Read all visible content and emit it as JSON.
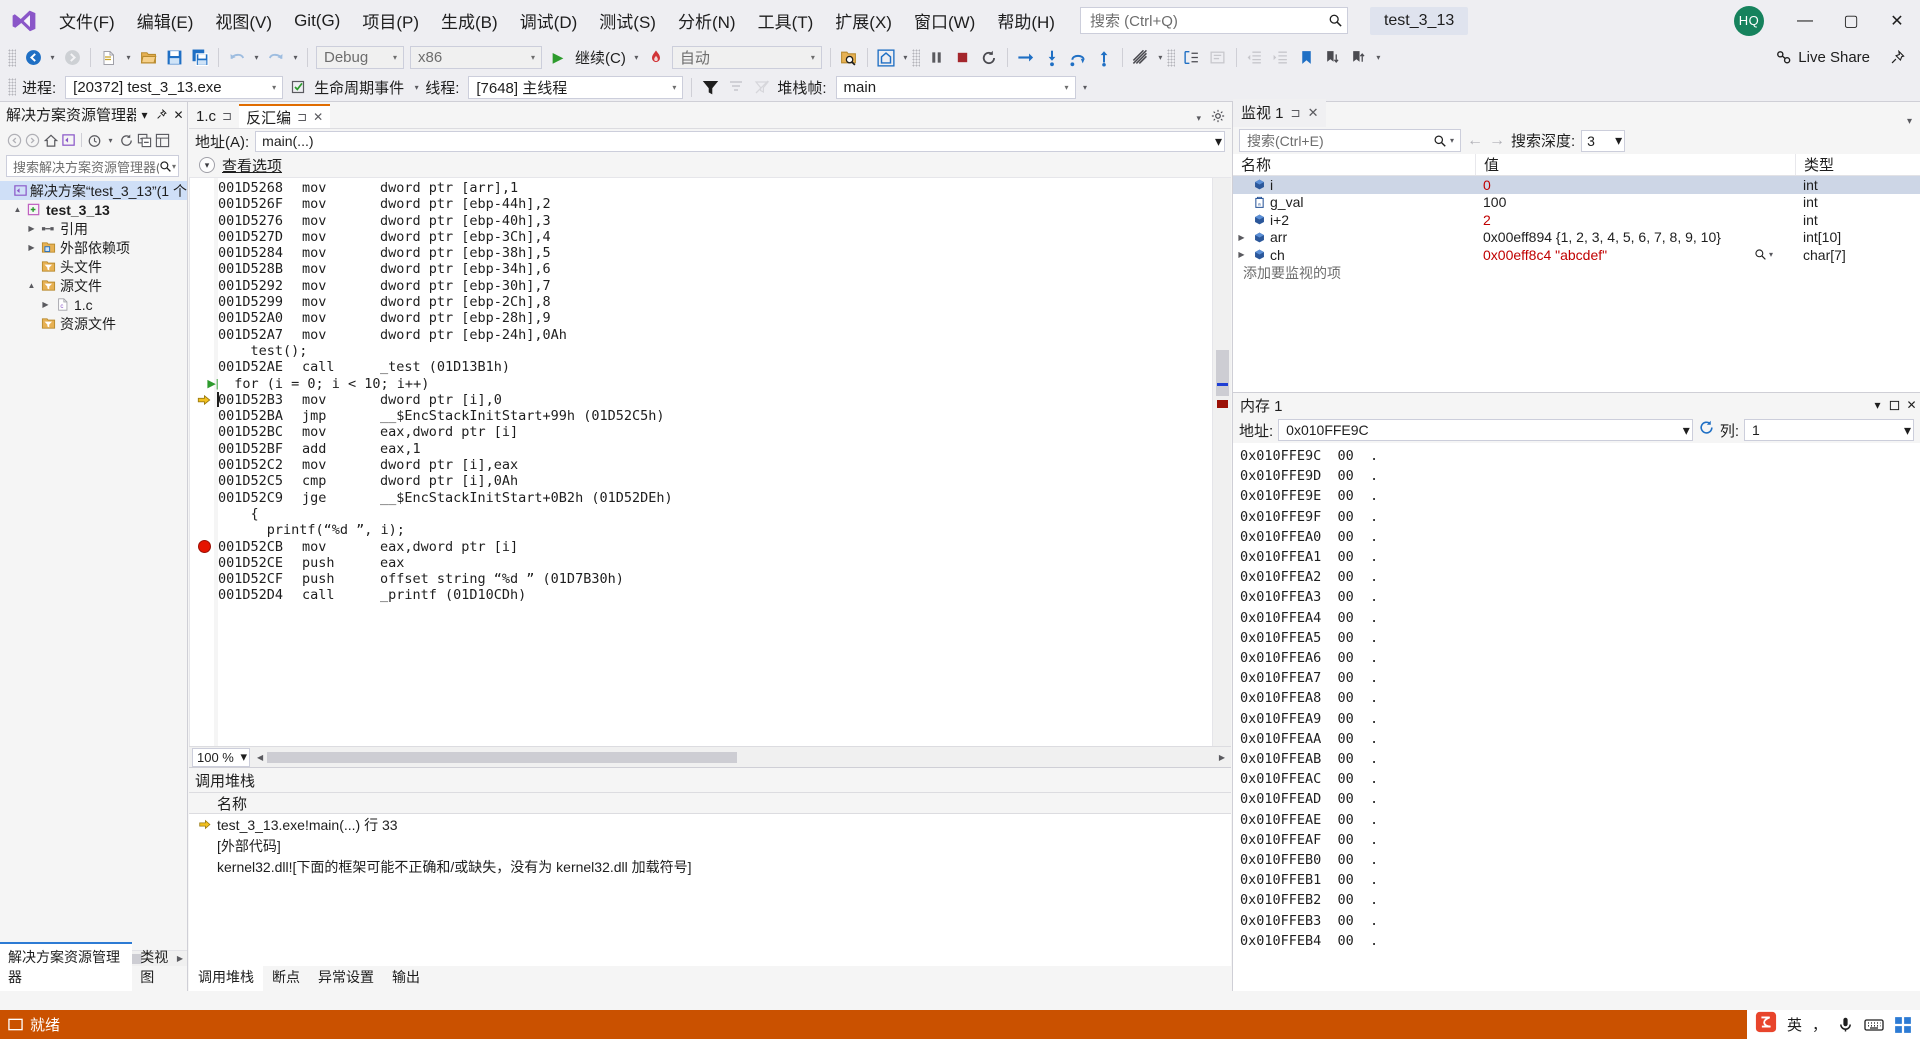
{
  "titlebar": {
    "logo_icon": "visual-studio-logo",
    "menus": [
      {
        "label": "文件(F)"
      },
      {
        "label": "编辑(E)"
      },
      {
        "label": "视图(V)"
      },
      {
        "label": "Git(G)"
      },
      {
        "label": "项目(P)"
      },
      {
        "label": "生成(B)"
      },
      {
        "label": "调试(D)"
      },
      {
        "label": "测试(S)"
      },
      {
        "label": "分析(N)"
      },
      {
        "label": "工具(T)"
      },
      {
        "label": "扩展(X)"
      },
      {
        "label": "窗口(W)"
      },
      {
        "label": "帮助(H)"
      }
    ],
    "search_placeholder": "搜索 (Ctrl+Q)",
    "search_icon": "search-icon",
    "project_title": "test_3_13",
    "account_initials": "HQ",
    "minimize": "—",
    "maximize": "▢",
    "close": "✕"
  },
  "toolbar": {
    "nav_back_icon": "navigate-back-icon",
    "nav_forward_icon": "navigate-forward-icon",
    "new_item_icon": "new-file-icon",
    "open_icon": "open-folder-icon",
    "save_icon": "save-icon",
    "save_all_icon": "save-all-icon",
    "undo_icon": "undo-icon",
    "redo_icon": "redo-icon",
    "config_value": "Debug",
    "platform_value": "x86",
    "continue_label": "继续(C)",
    "continue_icon": "play-icon",
    "hot_reload_icon": "hot-reload-icon",
    "auto_value": "自动",
    "find_icon": "find-in-files-icon",
    "home_icon": "home-icon",
    "pause_icon": "pause-icon",
    "stop_icon": "stop-icon",
    "restart_icon": "restart-icon",
    "show_next_statement_icon": "show-next-statement-icon",
    "step_into_icon": "step-into-icon",
    "step_over_icon": "step-over-icon",
    "step_out_icon": "step-out-icon",
    "threads_icon": "threads-icon",
    "bookmark_icon": "bookmark-icon",
    "comment_icon": "comment-icon",
    "uncomment_icon": "uncomment-icon",
    "indent_icon": "indent-icon",
    "outdent_icon": "outdent-icon",
    "live_share_label": "Live Share",
    "live_share_icon": "live-share-icon",
    "pin_icon": "pin-icon"
  },
  "debugbar": {
    "process_label": "进程:",
    "process_value": "[20372] test_3_13.exe",
    "lifecycle_label": "生命周期事件",
    "lifecycle_icon": "lifecycle-events-icon",
    "thread_label": "线程:",
    "thread_value": "[7648] 主线程",
    "filter_icon": "filter-icon",
    "stackframe_label": "堆栈帧:",
    "stackframe_value": "main"
  },
  "solution_explorer": {
    "title": "解决方案资源管理器",
    "dropdown_icon": "chevron-down-icon",
    "pin_icon": "pin-icon",
    "close_icon": "close-icon",
    "toolbar_icons": [
      "back-icon",
      "forward-icon",
      "home-icon",
      "sync-with-active-doc-icon",
      "pending-changes-icon",
      "refresh-icon",
      "collapse-all-icon",
      "properties-icon"
    ],
    "search_placeholder": "搜索解决方案资源管理器(",
    "search_icon": "search-icon",
    "tree": [
      {
        "label": "解决方案“test_3_13”(1 个",
        "icon": "solution-icon",
        "indent": 0,
        "arrow": "",
        "bold": false,
        "selected": true
      },
      {
        "label": "test_3_13",
        "icon": "cpp-project-icon",
        "indent": 1,
        "arrow": "▲",
        "bold": true,
        "selected": false
      },
      {
        "label": "引用",
        "icon": "references-icon",
        "indent": 2,
        "arrow": "▶",
        "bold": false,
        "selected": false
      },
      {
        "label": "外部依赖项",
        "icon": "external-deps-icon",
        "indent": 2,
        "arrow": "▶",
        "bold": false,
        "selected": false
      },
      {
        "label": "头文件",
        "icon": "filter-folder-icon",
        "indent": 2,
        "arrow": "",
        "bold": false,
        "selected": false
      },
      {
        "label": "源文件",
        "icon": "filter-folder-icon",
        "indent": 2,
        "arrow": "▲",
        "bold": false,
        "selected": false
      },
      {
        "label": "1.c",
        "icon": "c-file-icon",
        "indent": 3,
        "arrow": "▶",
        "bold": false,
        "selected": false
      },
      {
        "label": "资源文件",
        "icon": "filter-folder-icon",
        "indent": 2,
        "arrow": "",
        "bold": false,
        "selected": false
      }
    ],
    "tabs": [
      {
        "label": "解决方案资源管理器",
        "active": true
      },
      {
        "label": "类视图",
        "active": false
      }
    ]
  },
  "editor": {
    "tabs": [
      {
        "label": "1.c",
        "active": false,
        "pin_icon": "pin-icon",
        "close": ""
      },
      {
        "label": "反汇编",
        "active": true,
        "pin_icon": "pin-icon",
        "close": "✕"
      }
    ],
    "tab_dropdown_icon": "chevron-down-icon",
    "tab_settings_icon": "gear-icon",
    "address_label": "地址(A):",
    "address_value": "main(...)",
    "address_dropdown_icon": "chevron-down-icon",
    "view_options_label": "查看选项",
    "view_options_icon": "chevron-down-icon",
    "zoom_value": "100 %",
    "lines": [
      {
        "addr": "001D5268",
        "mn": "mov",
        "ops": "dword ptr [arr],1",
        "kind": "asm",
        "mark": ""
      },
      {
        "addr": "001D526F",
        "mn": "mov",
        "ops": "dword ptr [ebp-44h],2",
        "kind": "asm",
        "mark": ""
      },
      {
        "addr": "001D5276",
        "mn": "mov",
        "ops": "dword ptr [ebp-40h],3",
        "kind": "asm",
        "mark": ""
      },
      {
        "addr": "001D527D",
        "mn": "mov",
        "ops": "dword ptr [ebp-3Ch],4",
        "kind": "asm",
        "mark": ""
      },
      {
        "addr": "001D5284",
        "mn": "mov",
        "ops": "dword ptr [ebp-38h],5",
        "kind": "asm",
        "mark": ""
      },
      {
        "addr": "001D528B",
        "mn": "mov",
        "ops": "dword ptr [ebp-34h],6",
        "kind": "asm",
        "mark": ""
      },
      {
        "addr": "001D5292",
        "mn": "mov",
        "ops": "dword ptr [ebp-30h],7",
        "kind": "asm",
        "mark": ""
      },
      {
        "addr": "001D5299",
        "mn": "mov",
        "ops": "dword ptr [ebp-2Ch],8",
        "kind": "asm",
        "mark": ""
      },
      {
        "addr": "001D52A0",
        "mn": "mov",
        "ops": "dword ptr [ebp-28h],9",
        "kind": "asm",
        "mark": ""
      },
      {
        "addr": "001D52A7",
        "mn": "mov",
        "ops": "dword ptr [ebp-24h],0Ah",
        "kind": "asm",
        "mark": ""
      },
      {
        "src": "    test();",
        "kind": "src",
        "mark": ""
      },
      {
        "addr": "001D52AE",
        "mn": "call",
        "ops": "_test (01D13B1h)",
        "kind": "asm",
        "mark": ""
      },
      {
        "src": "  for (i = 0; i < 10; i++)",
        "kind": "src",
        "mark": "step"
      },
      {
        "addr": "001D52B3",
        "mn": "mov",
        "ops": "dword ptr [i],0",
        "kind": "asm",
        "mark": "current"
      },
      {
        "addr": "001D52BA",
        "mn": "jmp",
        "ops": "__$EncStackInitStart+99h (01D52C5h)",
        "kind": "asm",
        "mark": ""
      },
      {
        "addr": "001D52BC",
        "mn": "mov",
        "ops": "eax,dword ptr [i]",
        "kind": "asm",
        "mark": ""
      },
      {
        "addr": "001D52BF",
        "mn": "add",
        "ops": "eax,1",
        "kind": "asm",
        "mark": ""
      },
      {
        "addr": "001D52C2",
        "mn": "mov",
        "ops": "dword ptr [i],eax",
        "kind": "asm",
        "mark": ""
      },
      {
        "addr": "001D52C5",
        "mn": "cmp",
        "ops": "dword ptr [i],0Ah",
        "kind": "asm",
        "mark": ""
      },
      {
        "addr": "001D52C9",
        "mn": "jge",
        "ops": "__$EncStackInitStart+0B2h (01D52DEh)",
        "kind": "asm",
        "mark": ""
      },
      {
        "src": "    {",
        "kind": "src",
        "mark": ""
      },
      {
        "src": "      printf(“%d ”, i);",
        "kind": "src",
        "mark": ""
      },
      {
        "addr": "001D52CB",
        "mn": "mov",
        "ops": "eax,dword ptr [i]",
        "kind": "asm",
        "mark": "breakpoint"
      },
      {
        "addr": "001D52CE",
        "mn": "push",
        "ops": "eax",
        "kind": "asm",
        "mark": ""
      },
      {
        "addr": "001D52CF",
        "mn": "push",
        "ops": "offset string “%d ” (01D7B30h)",
        "kind": "asm",
        "mark": ""
      },
      {
        "addr": "001D52D4",
        "mn": "call",
        "ops": "_printf (01D10CDh)",
        "kind": "asm",
        "mark": ""
      }
    ]
  },
  "callstack": {
    "title": "调用堆栈",
    "column_name": "名称",
    "rows": [
      {
        "text": "test_3_13.exe!main(...) 行 33",
        "icon": "current-frame-arrow-icon"
      },
      {
        "text": "[外部代码]",
        "icon": ""
      },
      {
        "text": "kernel32.dll![下面的框架可能不正确和/或缺失，没有为 kernel32.dll 加载符号]",
        "icon": ""
      }
    ],
    "tabs": [
      {
        "label": "调用堆栈",
        "active": true
      },
      {
        "label": "断点",
        "active": false
      },
      {
        "label": "异常设置",
        "active": false
      },
      {
        "label": "输出",
        "active": false
      }
    ]
  },
  "watch": {
    "tab_label": "监视 1",
    "pin_icon": "pin-icon",
    "close_icon": "close-icon",
    "search_placeholder": "搜索(Ctrl+E)",
    "search_icon": "search-icon",
    "search_dropdown_icon": "chevron-down-icon",
    "prev_icon": "arrow-left-icon",
    "next_icon": "arrow-right-icon",
    "depth_label": "搜索深度:",
    "depth_value": "3",
    "col_name": "名称",
    "col_value": "值",
    "col_type": "类型",
    "rows": [
      {
        "name": "i",
        "value": "0",
        "type": "int",
        "icon": "variable-icon",
        "expandable": false,
        "selected": true,
        "value_color": "#c00000",
        "magnifier": false
      },
      {
        "name": "g_val",
        "value": "100",
        "type": "int",
        "icon": "global-variable-icon",
        "expandable": false,
        "selected": false,
        "value_color": "#1e1e1e",
        "magnifier": false
      },
      {
        "name": "i+2",
        "value": "2",
        "type": "int",
        "icon": "variable-icon",
        "expandable": false,
        "selected": false,
        "value_color": "#c00000",
        "magnifier": false
      },
      {
        "name": "arr",
        "value": "0x00eff894 {1, 2, 3, 4, 5, 6, 7, 8, 9, 10}",
        "type": "int[10]",
        "icon": "variable-icon",
        "expandable": true,
        "selected": false,
        "value_color": "#1e1e1e",
        "magnifier": false
      },
      {
        "name": "ch",
        "value": "0x00eff8c4 \"abcdef\"",
        "type": "char[7]",
        "icon": "variable-icon",
        "expandable": true,
        "selected": false,
        "value_color": "#c00000",
        "magnifier": true
      }
    ],
    "add_placeholder": "添加要监视的项"
  },
  "memory": {
    "title": "内存 1",
    "minimize_icon": "chevron-down-icon",
    "float_icon": "float-window-icon",
    "close_icon": "close-icon",
    "address_label": "地址:",
    "address_value": "0x010FFE9C",
    "refresh_icon": "refresh-icon",
    "columns_label": "列:",
    "columns_value": "1",
    "rows": [
      {
        "addr": "0x010FFE9C",
        "byte": "00",
        "ascii": "."
      },
      {
        "addr": "0x010FFE9D",
        "byte": "00",
        "ascii": "."
      },
      {
        "addr": "0x010FFE9E",
        "byte": "00",
        "ascii": "."
      },
      {
        "addr": "0x010FFE9F",
        "byte": "00",
        "ascii": "."
      },
      {
        "addr": "0x010FFEA0",
        "byte": "00",
        "ascii": "."
      },
      {
        "addr": "0x010FFEA1",
        "byte": "00",
        "ascii": "."
      },
      {
        "addr": "0x010FFEA2",
        "byte": "00",
        "ascii": "."
      },
      {
        "addr": "0x010FFEA3",
        "byte": "00",
        "ascii": "."
      },
      {
        "addr": "0x010FFEA4",
        "byte": "00",
        "ascii": "."
      },
      {
        "addr": "0x010FFEA5",
        "byte": "00",
        "ascii": "."
      },
      {
        "addr": "0x010FFEA6",
        "byte": "00",
        "ascii": "."
      },
      {
        "addr": "0x010FFEA7",
        "byte": "00",
        "ascii": "."
      },
      {
        "addr": "0x010FFEA8",
        "byte": "00",
        "ascii": "."
      },
      {
        "addr": "0x010FFEA9",
        "byte": "00",
        "ascii": "."
      },
      {
        "addr": "0x010FFEAA",
        "byte": "00",
        "ascii": "."
      },
      {
        "addr": "0x010FFEAB",
        "byte": "00",
        "ascii": "."
      },
      {
        "addr": "0x010FFEAC",
        "byte": "00",
        "ascii": "."
      },
      {
        "addr": "0x010FFEAD",
        "byte": "00",
        "ascii": "."
      },
      {
        "addr": "0x010FFEAE",
        "byte": "00",
        "ascii": "."
      },
      {
        "addr": "0x010FFEAF",
        "byte": "00",
        "ascii": "."
      },
      {
        "addr": "0x010FFEB0",
        "byte": "00",
        "ascii": "."
      },
      {
        "addr": "0x010FFEB1",
        "byte": "00",
        "ascii": "."
      },
      {
        "addr": "0x010FFEB2",
        "byte": "00",
        "ascii": "."
      },
      {
        "addr": "0x010FFEB3",
        "byte": "00",
        "ascii": "."
      },
      {
        "addr": "0x010FFEB4",
        "byte": "00",
        "ascii": "."
      }
    ]
  },
  "statusbar": {
    "text": "就绪",
    "icon": "ready-icon"
  },
  "tray": {
    "ime_logo_icon": "sogou-ime-icon",
    "lang": "英",
    "comma_icon": "punctuation-icon",
    "mic_icon": "microphone-icon",
    "keyboard_icon": "keyboard-icon",
    "apps_icon": "toolbox-icon"
  },
  "colors": {
    "accent": "#2d7bd4",
    "status_bg": "#ca5100",
    "breakpoint": "#e51400",
    "current_line": "#f2c01e",
    "value_modified": "#c00000"
  }
}
